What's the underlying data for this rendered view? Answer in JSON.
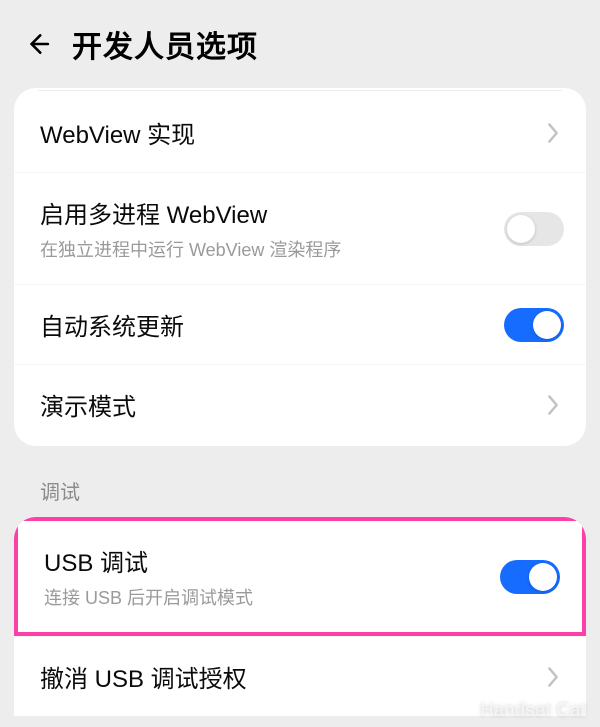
{
  "header": {
    "title": "开发人员选项"
  },
  "group1": {
    "webview_impl": {
      "label": "WebView 实现"
    },
    "multi_process_webview": {
      "label": "启用多进程 WebView",
      "sub": "在独立进程中运行 WebView 渲染程序",
      "toggle": false
    },
    "auto_system_update": {
      "label": "自动系统更新",
      "toggle": true
    },
    "demo_mode": {
      "label": "演示模式"
    }
  },
  "section_debug": {
    "title": "调试"
  },
  "group2": {
    "usb_debug": {
      "label": "USB 调试",
      "sub": "连接 USB 后开启调试模式",
      "toggle": true
    },
    "revoke_usb_auth": {
      "label": "撤消 USB 调试授权"
    }
  },
  "watermark": "Handset Cat"
}
